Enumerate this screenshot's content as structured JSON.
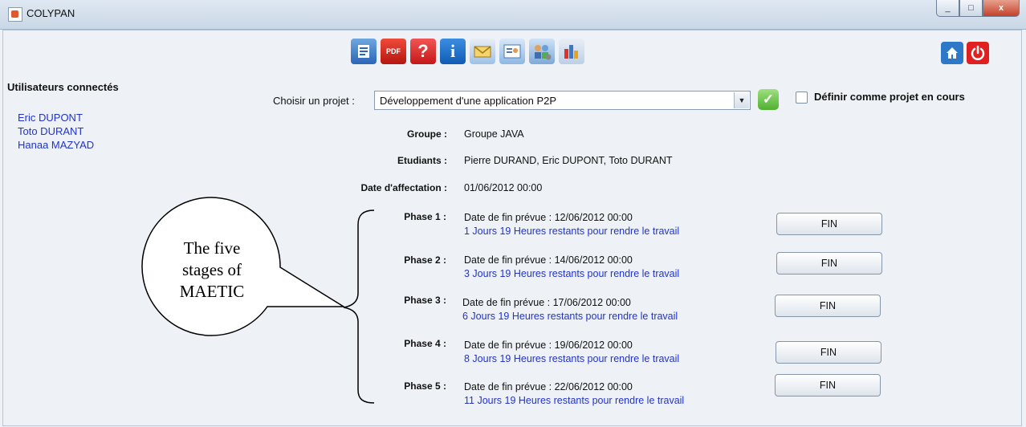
{
  "window": {
    "title": "COLYPAN",
    "controls": [
      "_",
      "□",
      "x"
    ]
  },
  "toolbar": {
    "icons": [
      "list-icon",
      "pdf-icon",
      "help-icon",
      "info-icon",
      "mail-icon",
      "contact-icon",
      "users-settings-icon",
      "chart-icon"
    ],
    "pdf_text": "PDF",
    "help_text": "?",
    "info_text": "i"
  },
  "sidebar": {
    "title": "Utilisateurs connectés",
    "users": [
      "Eric DUPONT",
      "Toto DURANT",
      "Hanaa MAZYAD"
    ]
  },
  "project": {
    "choose_label": "Choisir un projet :",
    "selected": "Développement d'une application P2P",
    "set_current_label": "Définir comme projet en cours",
    "set_current_checked": false
  },
  "details": {
    "group_label": "Groupe :",
    "group_value": "Groupe JAVA",
    "students_label": "Etudiants :",
    "students_value": "Pierre DURAND, Eric DUPONT, Toto DURANT",
    "date_label": "Date d'affectation :",
    "date_value": "01/06/2012 00:00"
  },
  "phases": [
    {
      "label": "Phase 1 :",
      "due": "Date de fin prévue : 12/06/2012 00:00",
      "remaining": "1 Jours 19 Heures restants pour rendre le travail",
      "button": "FIN"
    },
    {
      "label": "Phase 2 :",
      "due": "Date de fin prévue : 14/06/2012 00:00",
      "remaining": "3 Jours 19 Heures restants pour rendre le travail",
      "button": "FIN"
    },
    {
      "label": "Phase 3 :",
      "due": "Date de fin prévue : 17/06/2012 00:00",
      "remaining": "6 Jours 19 Heures restants pour rendre le travail",
      "button": "FIN"
    },
    {
      "label": "Phase 4 :",
      "due": "Date de fin prévue : 19/06/2012 00:00",
      "remaining": "8 Jours 19 Heures restants pour rendre le travail",
      "button": "FIN"
    },
    {
      "label": "Phase 5 :",
      "due": "Date de fin prévue : 22/06/2012 00:00",
      "remaining": "11 Jours 19 Heures restants pour rendre le travail",
      "button": "FIN"
    }
  ],
  "annotation": {
    "line1": "The five",
    "line2": "stages of",
    "line3": "MAETIC"
  },
  "colors": {
    "link_blue": "#2233cc",
    "ok_green": "#4fb032",
    "power_red": "#e02020",
    "home_blue": "#2d78c7"
  }
}
